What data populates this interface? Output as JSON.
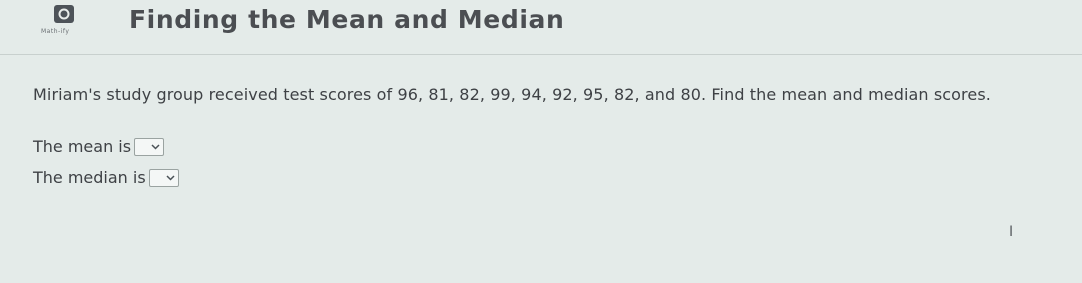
{
  "header": {
    "logo_icon": "logo-icon",
    "logo_text": "Math-ify",
    "title": "Finding the Mean and Median"
  },
  "problem": {
    "text": "Miriam's study group received test scores of 96, 81, 82, 99, 94, 92, 95, 82, and 80. Find the mean and median scores."
  },
  "answers": {
    "mean_label": "The mean is",
    "mean_value": "",
    "median_label": "The median is",
    "median_value": ""
  },
  "cursor": {
    "glyph": "I"
  }
}
